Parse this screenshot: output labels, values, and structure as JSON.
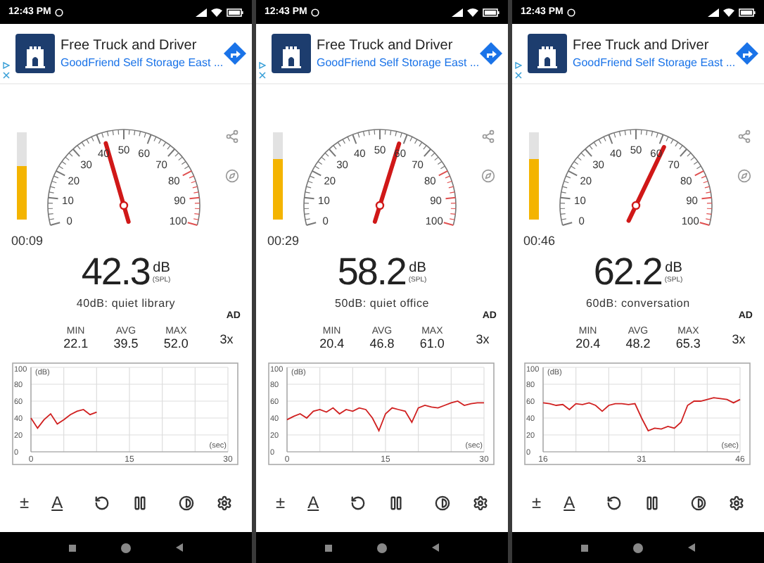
{
  "screens": [
    {
      "status_bar": {
        "time": "12:43 PM"
      },
      "ad": {
        "title": "Free Truck and Driver",
        "subtitle": "GoodFriend Self Storage East ..."
      },
      "meter": {
        "level": 0.62
      },
      "gauge": {
        "labels": [
          "50",
          "40",
          "60",
          "30",
          "70",
          "20",
          "80",
          "10",
          "90",
          "0",
          "100"
        ]
      },
      "timer": "00:09",
      "reading": {
        "value": "42.3",
        "unit": "dB",
        "weighting": "(SPL)"
      },
      "description": "40dB: quiet library",
      "ad_badge": "AD",
      "stats": [
        {
          "label": "MIN",
          "value": "22.1"
        },
        {
          "label": "AVG",
          "value": "39.5"
        },
        {
          "label": "MAX",
          "value": "52.0"
        }
      ],
      "zoom": "3x",
      "chart_data": {
        "type": "line",
        "grid": true,
        "ylabel": "(dB)",
        "xlabel": "(sec)",
        "xlim": [
          0,
          30
        ],
        "ylim": [
          0,
          100
        ],
        "yticks": [
          0,
          20,
          40,
          60,
          80,
          100
        ],
        "xticks": [
          0,
          15,
          30
        ],
        "x": [
          0,
          1,
          2,
          3,
          4,
          5,
          6,
          7,
          8,
          9,
          10
        ],
        "values": [
          40,
          28,
          38,
          45,
          33,
          38,
          44,
          48,
          50,
          44,
          47
        ]
      },
      "toolbar": [
        {
          "kind": "text",
          "label": "±"
        },
        {
          "kind": "underlined",
          "label": "A"
        },
        {
          "kind": "reset"
        },
        {
          "kind": "pause"
        },
        {
          "kind": "theme"
        },
        {
          "kind": "settings"
        }
      ]
    },
    {
      "status_bar": {
        "time": "12:43 PM"
      },
      "ad": {
        "title": "Free Truck and Driver",
        "subtitle": "GoodFriend Self Storage East ..."
      },
      "meter": {
        "level": 0.7
      },
      "gauge": {
        "labels": [
          "50",
          "40",
          "60",
          "30",
          "70",
          "20",
          "80",
          "10",
          "90",
          "0",
          "100"
        ]
      },
      "timer": "00:29",
      "reading": {
        "value": "58.2",
        "unit": "dB",
        "weighting": "(SPL)"
      },
      "description": "50dB: quiet office",
      "ad_badge": "AD",
      "stats": [
        {
          "label": "MIN",
          "value": "20.4"
        },
        {
          "label": "AVG",
          "value": "46.8"
        },
        {
          "label": "MAX",
          "value": "61.0"
        }
      ],
      "zoom": "3x",
      "chart_data": {
        "type": "line",
        "grid": true,
        "ylabel": "(dB)",
        "xlabel": "(sec)",
        "xlim": [
          0,
          30
        ],
        "ylim": [
          0,
          100
        ],
        "yticks": [
          0,
          20,
          40,
          60,
          80,
          100
        ],
        "xticks": [
          0,
          15,
          30
        ],
        "x": [
          0,
          1,
          2,
          3,
          4,
          5,
          6,
          7,
          8,
          9,
          10,
          11,
          12,
          13,
          14,
          15,
          16,
          17,
          18,
          19,
          20,
          21,
          22,
          23,
          24,
          25,
          26,
          27,
          28,
          29,
          30
        ],
        "values": [
          38,
          42,
          45,
          40,
          48,
          50,
          47,
          52,
          45,
          50,
          48,
          52,
          50,
          40,
          25,
          45,
          52,
          50,
          48,
          35,
          52,
          55,
          53,
          52,
          55,
          58,
          60,
          55,
          57,
          58,
          58
        ]
      },
      "toolbar": [
        {
          "kind": "text",
          "label": "±"
        },
        {
          "kind": "underlined",
          "label": "A"
        },
        {
          "kind": "reset"
        },
        {
          "kind": "pause"
        },
        {
          "kind": "theme"
        },
        {
          "kind": "settings"
        }
      ]
    },
    {
      "status_bar": {
        "time": "12:43 PM"
      },
      "ad": {
        "title": "Free Truck and Driver",
        "subtitle": "GoodFriend Self Storage East ..."
      },
      "meter": {
        "level": 0.7
      },
      "gauge": {
        "labels": [
          "50",
          "40",
          "60",
          "30",
          "70",
          "20",
          "80",
          "10",
          "90",
          "0",
          "100"
        ]
      },
      "timer": "00:46",
      "reading": {
        "value": "62.2",
        "unit": "dB",
        "weighting": "(SPL)"
      },
      "description": "60dB: conversation",
      "ad_badge": "AD",
      "stats": [
        {
          "label": "MIN",
          "value": "20.4"
        },
        {
          "label": "AVG",
          "value": "48.2"
        },
        {
          "label": "MAX",
          "value": "65.3"
        }
      ],
      "zoom": "3x",
      "chart_data": {
        "type": "line",
        "grid": true,
        "ylabel": "(dB)",
        "xlabel": "(sec)",
        "xlim": [
          16,
          46
        ],
        "ylim": [
          0,
          100
        ],
        "yticks": [
          0,
          20,
          40,
          60,
          80,
          100
        ],
        "xticks": [
          16,
          31,
          46
        ],
        "x": [
          16,
          17,
          18,
          19,
          20,
          21,
          22,
          23,
          24,
          25,
          26,
          27,
          28,
          29,
          30,
          31,
          32,
          33,
          34,
          35,
          36,
          37,
          38,
          39,
          40,
          41,
          42,
          43,
          44,
          45,
          46
        ],
        "values": [
          58,
          57,
          55,
          56,
          50,
          57,
          56,
          58,
          55,
          48,
          55,
          57,
          57,
          56,
          57,
          40,
          25,
          28,
          27,
          30,
          28,
          35,
          55,
          60,
          60,
          62,
          64,
          63,
          62,
          58,
          62
        ]
      },
      "toolbar": [
        {
          "kind": "text",
          "label": "±"
        },
        {
          "kind": "underlined",
          "label": "A"
        },
        {
          "kind": "reset"
        },
        {
          "kind": "pause"
        },
        {
          "kind": "theme"
        },
        {
          "kind": "settings"
        }
      ]
    }
  ]
}
